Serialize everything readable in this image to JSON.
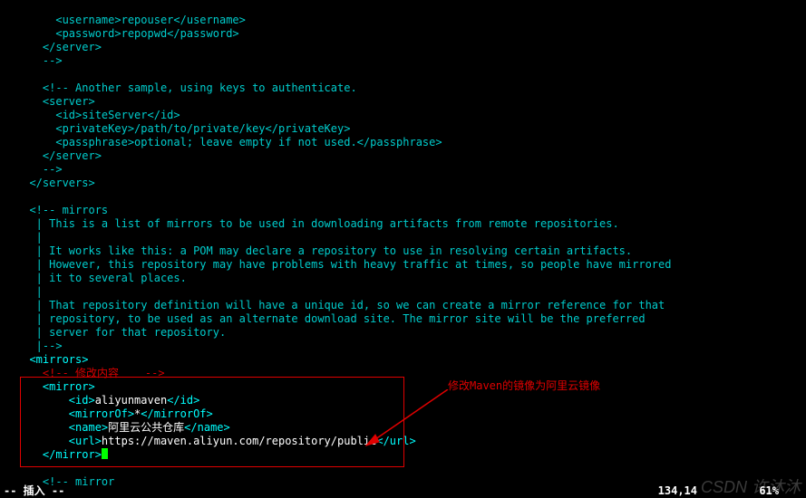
{
  "lines": {
    "l01": "      <username>repouser</username>",
    "l02": "      <password>repopwd</password>",
    "l03": "    </server>",
    "l04": "    -->",
    "l05": "",
    "l06": "    <!-- Another sample, using keys to authenticate.",
    "l07": "    <server>",
    "l08": "      <id>siteServer</id>",
    "l09": "      <privateKey>/path/to/private/key</privateKey>",
    "l10": "      <passphrase>optional; leave empty if not used.</passphrase>",
    "l11": "    </server>",
    "l12": "    -->",
    "l13": "  </servers>",
    "l14": "",
    "l15": "  <!-- mirrors",
    "l16": "   | This is a list of mirrors to be used in downloading artifacts from remote repositories.",
    "l17": "   |",
    "l18": "   | It works like this: a POM may declare a repository to use in resolving certain artifacts.",
    "l19": "   | However, this repository may have problems with heavy traffic at times, so people have mirrored",
    "l20": "   | it to several places.",
    "l21": "   |",
    "l22": "   | That repository definition will have a unique id, so we can create a mirror reference for that",
    "l23": "   | repository, to be used as an alternate download site. The mirror site will be the preferred",
    "l24": "   | server for that repository.",
    "l25": "   |-->",
    "l26a": "  ",
    "l26b": "<mirrors>",
    "l27": "    <!-- 修改内容    -->",
    "l28a": "    ",
    "l28b": "<mirror>",
    "l29a": "        ",
    "l29t1": "<id>",
    "l29v": "aliyunmaven",
    "l29t2": "</id>",
    "l30a": "        ",
    "l30t1": "<mirrorOf>",
    "l30v": "*",
    "l30t2": "</mirrorOf>",
    "l31a": "        ",
    "l31t1": "<name>",
    "l31v": "阿里云公共仓库",
    "l31t2": "</name>",
    "l32a": "        ",
    "l32t1": "<url>",
    "l32v": "https://maven.aliyun.com/repository/public",
    "l32t2": "</url>",
    "l33a": "    ",
    "l33b": "</mirror>",
    "l34": "",
    "l35": "    <!-- mirror"
  },
  "annotation": "修改Maven的镜像为阿里云镜像",
  "status": {
    "mode": "-- 插入 --",
    "pos": "134,14",
    "pct": "61%"
  },
  "watermark": "CSDN 许沐沐"
}
